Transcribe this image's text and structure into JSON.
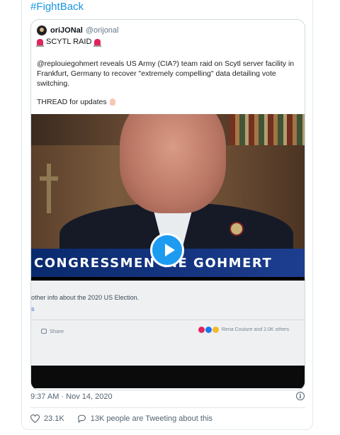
{
  "tweet": {
    "hashtag": "#FightBack",
    "timestamp": "9:37 AM · Nov 14, 2020",
    "likes": "23.1K",
    "tweeting_about": "13K people are Tweeting about this"
  },
  "quoted_tweet": {
    "display_name": "oriJONal",
    "handle": "@orijonal",
    "title": "SCYTL RAID",
    "body": "@replouiegohmert reveals US Army (CIA?) team raid on Scytl server facility in Frankfurt, Germany to recover  \"extremely compelling\" data detailing vote switching.",
    "thread_text": "THREAD for updates"
  },
  "video": {
    "banner_text": "CONGRESSMEN  UIE GOHMERT",
    "page_text": "other info about the 2020 US Election.",
    "page_link": "s",
    "share_label": "Share",
    "reactions_text": "Rena Couture and 2.0K others"
  },
  "icons": {
    "play": "play-button-icon",
    "heart": "heart-icon",
    "reply": "reply-icon",
    "info": "info-icon",
    "siren": "siren-icon"
  },
  "colors": {
    "link": "#1b95e0",
    "play": "#1d9bf0",
    "banner": "#0a2a6e"
  }
}
